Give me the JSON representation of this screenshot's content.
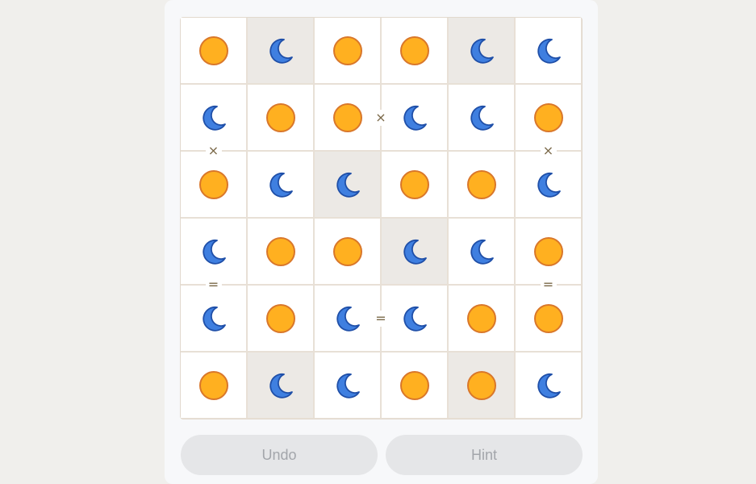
{
  "board": {
    "size": 6,
    "cells": [
      [
        "sun",
        "moon",
        "sun",
        "sun",
        "moon",
        "moon"
      ],
      [
        "moon",
        "sun",
        "sun",
        "moon",
        "moon",
        "sun"
      ],
      [
        "sun",
        "moon",
        "moon",
        "sun",
        "sun",
        "moon"
      ],
      [
        "moon",
        "sun",
        "sun",
        "moon",
        "moon",
        "sun"
      ],
      [
        "moon",
        "sun",
        "moon",
        "moon",
        "sun",
        "sun"
      ],
      [
        "sun",
        "moon",
        "moon",
        "sun",
        "sun",
        "moon"
      ]
    ],
    "locked": [
      [
        false,
        true,
        false,
        false,
        true,
        false
      ],
      [
        false,
        false,
        false,
        false,
        false,
        false
      ],
      [
        false,
        false,
        true,
        false,
        false,
        false
      ],
      [
        false,
        false,
        false,
        true,
        false,
        false
      ],
      [
        false,
        false,
        false,
        false,
        false,
        false
      ],
      [
        false,
        true,
        false,
        false,
        true,
        false
      ]
    ],
    "constraints": [
      {
        "symbol": "×",
        "orientation": "horizontal",
        "row": 1,
        "col": 2
      },
      {
        "symbol": "×",
        "orientation": "vertical",
        "row": 1,
        "col": 0
      },
      {
        "symbol": "×",
        "orientation": "vertical",
        "row": 1,
        "col": 5
      },
      {
        "symbol": "=",
        "orientation": "vertical",
        "row": 3,
        "col": 0
      },
      {
        "symbol": "=",
        "orientation": "vertical",
        "row": 3,
        "col": 5
      },
      {
        "symbol": "=",
        "orientation": "horizontal",
        "row": 4,
        "col": 2
      }
    ]
  },
  "icons": {
    "sun": "sun-icon",
    "moon": "moon-icon"
  },
  "colors": {
    "sun_fill": "#ffb020",
    "sun_stroke": "#d9772a",
    "moon_fill": "#3f7fe0",
    "moon_stroke": "#1f4fa8",
    "constraint": "#7a6848"
  },
  "controls": {
    "undo_label": "Undo",
    "hint_label": "Hint"
  }
}
